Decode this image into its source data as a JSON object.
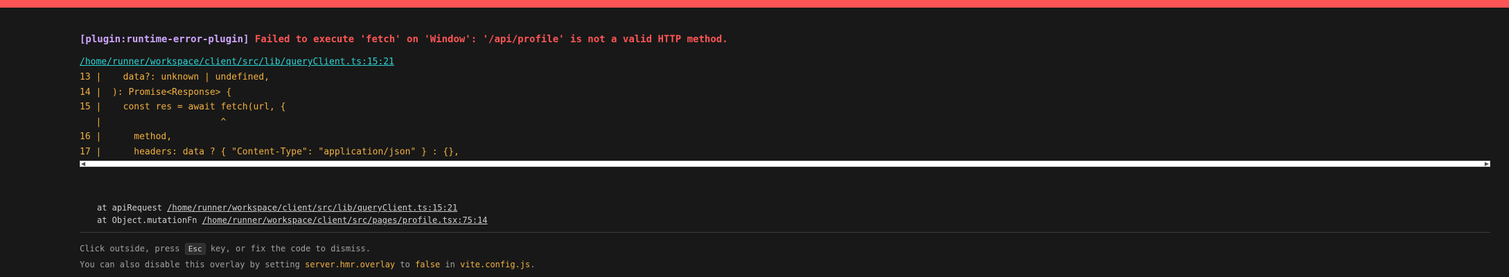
{
  "colors": {
    "border_top": "#ff5555",
    "background": "#181818",
    "plugin": "#cfa6ff",
    "error": "#ff5555",
    "file_link": "#2dd4d4",
    "code": "#f0b040"
  },
  "error": {
    "plugin": "[plugin:runtime-error-plugin]",
    "message": "Failed to execute 'fetch' on 'Window': '/api/profile' is not a valid HTTP method."
  },
  "file": "/home/runner/workspace/client/src/lib/queryClient.ts:15:21",
  "frame": [
    "13 |    data?: unknown | undefined,",
    "14 |  ): Promise<Response> {",
    "15 |    const res = await fetch(url, {",
    "   |                      ^",
    "16 |      method,",
    "17 |      headers: data ? { \"Content-Type\": \"application/json\" } : {},"
  ],
  "scrollbar": {
    "left_arrow": "◀",
    "right_arrow": "▶"
  },
  "stack": [
    {
      "prefix": "at apiRequest ",
      "location": "/home/runner/workspace/client/src/lib/queryClient.ts:15:21"
    },
    {
      "prefix": "at Object.mutationFn ",
      "location": "/home/runner/workspace/client/src/pages/profile.tsx:75:14"
    }
  ],
  "tip": {
    "line1_before": "Click outside, press ",
    "line1_key": "Esc",
    "line1_after": " key, or fix the code to dismiss.",
    "line2_before": "You can also disable this overlay by setting ",
    "line2_setting": "server.hmr.overlay",
    "line2_mid1": " to ",
    "line2_value": "false",
    "line2_mid2": " in ",
    "line2_file": "vite.config.js",
    "line2_end": "."
  }
}
